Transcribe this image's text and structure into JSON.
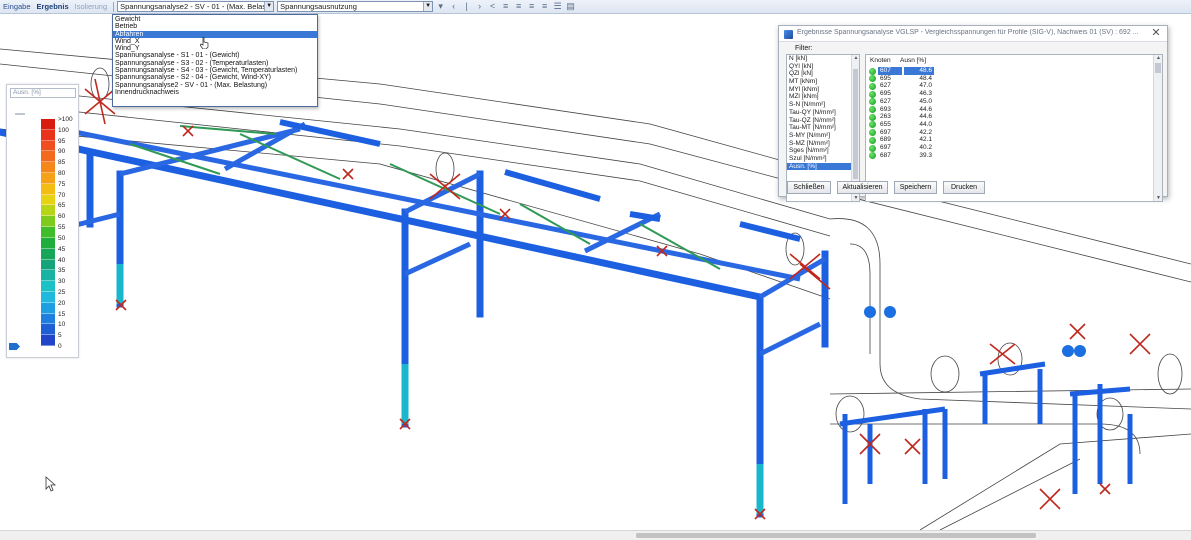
{
  "toolbar": {
    "tabs": [
      "Eingabe",
      "Ergebnis",
      "Isolierung"
    ],
    "load_case_combo": "Spannungsanalyse2 - SV - 01 - (Max. Belastu",
    "result_type_combo": "Spannungsausnutzung"
  },
  "dropdown": {
    "items": [
      "Gewicht",
      "Betrieb",
      "Abfahren",
      "Wind_X",
      "Wind_Y",
      "Spannungsanalyse - S1 - 01 - (Gewicht)",
      "Spannungsanalyse - S3 - 02 - (Temperaturlasten)",
      "Spannungsanalyse - S4 - 03 - (Gewicht, Temperaturlasten)",
      "Spannungsanalyse - S2 - 04 - (Gewicht, Wind-XY)",
      "Spannungsanalyse2 - SV - 01 - (Max. Belastung)",
      "Innendrucknachweis"
    ],
    "selected_index": 2
  },
  "legend": {
    "title": "Ausn. [%]",
    "labels": [
      ">100",
      "100",
      "95",
      "90",
      "85",
      "80",
      "75",
      "70",
      "65",
      "60",
      "55",
      "50",
      "45",
      "40",
      "35",
      "30",
      "25",
      "20",
      "15",
      "10",
      "5",
      "0"
    ],
    "colors": [
      "#d91c10",
      "#e8331a",
      "#f04e1e",
      "#f36a1d",
      "#f5861a",
      "#f6a218",
      "#f4bd14",
      "#e6d212",
      "#b7d416",
      "#7fcb1d",
      "#3fbd2a",
      "#1fae3c",
      "#16a65a",
      "#15a37b",
      "#18b3a2",
      "#1cc1c6",
      "#20b8dd",
      "#1f9fe3",
      "#1f7fe0",
      "#1f5fd6",
      "#2244c8"
    ]
  },
  "dialog": {
    "title": "Ergebnisse Spannungsanalyse VGLSP - Vergleichsspannungen für Profile (SIG-V), Nachweis 01 (SV) : 692 ...",
    "filter_label": "Filter:",
    "filter_items": [
      "N [kN]",
      "QYl [kN]",
      "QZl [kN]",
      "MT [kNm]",
      "MYl [kNm]",
      "MZl [kNm]",
      "S-N [N/mm²]",
      "Tau-QY [N/mm²]",
      "Tau-QZ [N/mm²]",
      "Tau-MT [N/mm²]",
      "S-MY [N/mm²]",
      "S-MZ [N/mm²]",
      "Sges [N/mm²]",
      "Szul [N/mm²]",
      "Ausn. [%]"
    ],
    "filter_selected_index": 14,
    "col_node": "Knoten",
    "col_util": "Ausn [%]",
    "rows": [
      {
        "node": "607",
        "value": "48.6"
      },
      {
        "node": "695",
        "value": "48.4"
      },
      {
        "node": "627",
        "value": "47.0"
      },
      {
        "node": "695",
        "value": "46.3"
      },
      {
        "node": "627",
        "value": "45.0"
      },
      {
        "node": "693",
        "value": "44.6"
      },
      {
        "node": "263",
        "value": "44.6"
      },
      {
        "node": "655",
        "value": "44.0"
      },
      {
        "node": "697",
        "value": "42.2"
      },
      {
        "node": "689",
        "value": "42.1"
      },
      {
        "node": "697",
        "value": "40.2"
      },
      {
        "node": "687",
        "value": "39.3"
      }
    ],
    "selected_row": 0,
    "buttons": {
      "close": "Schließen",
      "refresh": "Aktualisieren",
      "save": "Speichern",
      "print": "Drucken"
    }
  },
  "colors": {
    "beam_blue": "#1c5fe0",
    "beam_dark": "#0c2e8a",
    "brace_green": "#2f9a55",
    "support_red": "#c0281e",
    "pipe_outline": "#3a3a3a"
  }
}
